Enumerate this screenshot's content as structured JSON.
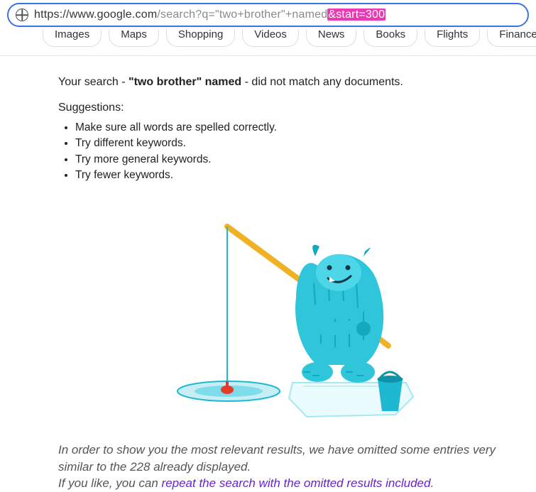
{
  "url": {
    "scheme": "https",
    "host": "://www.google.com",
    "path_gray": "/search?q=\"two+brother\"+named",
    "highlight": "&start=300"
  },
  "tabs": {
    "items": [
      {
        "label": "Images"
      },
      {
        "label": "Maps"
      },
      {
        "label": "Shopping"
      },
      {
        "label": "Videos"
      },
      {
        "label": "News"
      },
      {
        "label": "Books"
      },
      {
        "label": "Flights"
      },
      {
        "label": "Finance"
      }
    ]
  },
  "message": {
    "prefix": "Your search - ",
    "query": "\"two brother\" named",
    "suffix": " - did not match any documents."
  },
  "suggestions": {
    "title": "Suggestions:",
    "items": [
      "Make sure all words are spelled correctly.",
      "Try different keywords.",
      "Try more general keywords.",
      "Try fewer keywords."
    ]
  },
  "omitted": {
    "line1_a": "In order to show you the most relevant results, we have omitted some entries very similar to the ",
    "count": "228",
    "line1_b": " already displayed.",
    "line2_a": "If you like, you can ",
    "link": "repeat the search with the omitted results included",
    "line2_b": "."
  }
}
